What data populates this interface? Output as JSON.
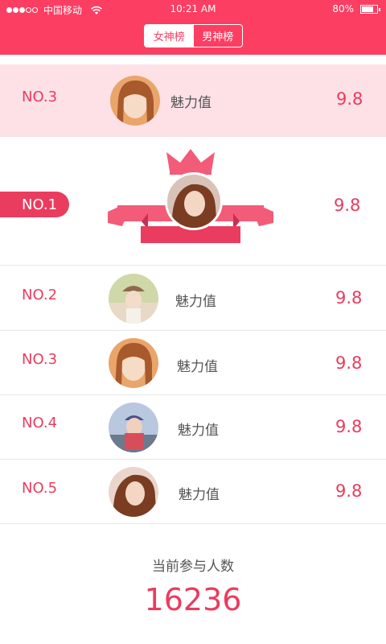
{
  "status_bar": {
    "carrier": "中国移动",
    "time": "10:21 AM",
    "battery_text": "80%",
    "battery_level": 0.8
  },
  "tabs": [
    {
      "label": "女神榜",
      "active": true
    },
    {
      "label": "男神榜",
      "active": false
    }
  ],
  "highlight_row": {
    "rank": "NO.3",
    "label": "魅力值",
    "score": "9.8"
  },
  "first_place": {
    "rank": "NO.1",
    "score": "9.8"
  },
  "rows": [
    {
      "rank": "NO.2",
      "label": "魅力值",
      "score": "9.8"
    },
    {
      "rank": "NO.3",
      "label": "魅力值",
      "score": "9.8"
    },
    {
      "rank": "NO.4",
      "label": "魅力值",
      "score": "9.8"
    },
    {
      "rank": "NO.5",
      "label": "魅力值",
      "score": "9.8"
    }
  ],
  "footer": {
    "label": "当前参与人数",
    "count": "16236"
  },
  "colors": {
    "brand": "#fb3e62",
    "accent_text": "#ea3c5f",
    "highlight_bg": "#fde1e6",
    "crown": "#f25c78"
  }
}
